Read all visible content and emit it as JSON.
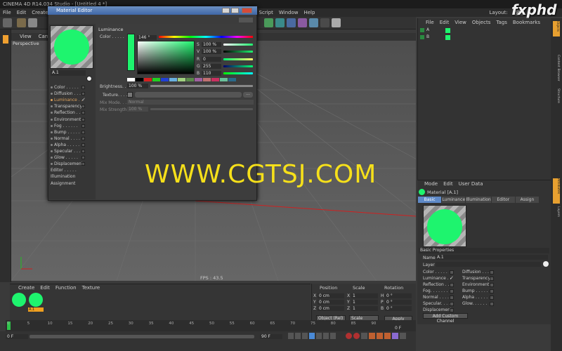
{
  "app": {
    "title": "CINEMA 4D R14.034 Studio - [Untitled 4 *]"
  },
  "menubar": [
    "File",
    "Edit",
    "Create",
    "Script",
    "Window",
    "Help"
  ],
  "layout": {
    "label": "Layout:",
    "value": "St"
  },
  "viewport": {
    "menu": [
      "View",
      "Cameras"
    ],
    "camera_label": "Perspective",
    "fps": "FPS : 43.5"
  },
  "object_manager": {
    "menu": [
      "File",
      "Edit",
      "View",
      "Objects",
      "Tags",
      "Bookmarks"
    ],
    "rows": [
      "A",
      "B"
    ]
  },
  "right_tabs": [
    "Objects",
    "Content Browser",
    "Structure",
    "Attributes",
    "Layers"
  ],
  "left_tabs": [
    "Tags",
    "Coord."
  ],
  "material_editor": {
    "title": "Material Editor",
    "material_name": "A.1",
    "channels": [
      {
        "label": "Color . . . . .",
        "checked": false,
        "active": false
      },
      {
        "label": "Diffusion . . .",
        "checked": false,
        "active": false
      },
      {
        "label": "Luminance . .",
        "checked": true,
        "active": true
      },
      {
        "label": "Transparency",
        "checked": false,
        "active": false
      },
      {
        "label": "Reflection . .",
        "checked": false,
        "active": false
      },
      {
        "label": "Environment",
        "checked": false,
        "active": false
      },
      {
        "label": "Fog . . . . . .",
        "checked": false,
        "active": false
      },
      {
        "label": "Bump . . . . .",
        "checked": false,
        "active": false
      },
      {
        "label": "Normal . . . .",
        "checked": false,
        "active": false
      },
      {
        "label": "Alpha . . . . .",
        "checked": false,
        "active": false
      },
      {
        "label": "Specular . . .",
        "checked": false,
        "active": false
      },
      {
        "label": "Glow . . . . .",
        "checked": false,
        "active": false
      },
      {
        "label": "Displacement",
        "checked": false,
        "active": false
      },
      {
        "label": "Editor . . . . .",
        "checked": null,
        "active": false
      },
      {
        "label": "Illumination",
        "checked": null,
        "active": false
      },
      {
        "label": "Assignment",
        "checked": null,
        "active": false
      }
    ],
    "section": "Luminance",
    "color_label": "Color . . . . .",
    "hue": "146 °",
    "s": "100 %",
    "v": "100 %",
    "r": "0",
    "g": "255",
    "b": "110",
    "brightness_label": "Brightness. .",
    "brightness": "100 %",
    "texture_label": "Texture. . . . .",
    "mix_mode_label": "Mix Mode. . .",
    "mix_mode": "Normal",
    "mix_strength_label": "Mix Strength",
    "mix_strength": "100 %",
    "swatch_color": "#1ef46e"
  },
  "attributes": {
    "menu": [
      "Mode",
      "Edit",
      "User Data"
    ],
    "title": "Material [A.1]",
    "tabs": [
      "Basic",
      "Luminance",
      "Illumination",
      "Editor",
      "Assign"
    ],
    "active_tab": "Basic",
    "section": "Basic Properties",
    "name_label": "Name",
    "name_value": "A.1",
    "layer_label": "Layer",
    "props_left": [
      {
        "label": "Color . . . . .",
        "checked": false
      },
      {
        "label": "Luminance . .",
        "checked": true
      },
      {
        "label": "Reflection . .",
        "checked": false
      },
      {
        "label": "Fog. . . . . . .",
        "checked": false
      },
      {
        "label": "Normal . . . .",
        "checked": false
      },
      {
        "label": "Specular. . . .",
        "checked": false
      },
      {
        "label": "Displacement",
        "checked": false
      }
    ],
    "props_right": [
      {
        "label": "Diffusion . . .",
        "checked": false
      },
      {
        "label": "Transparency",
        "checked": false
      },
      {
        "label": "Environment",
        "checked": false
      },
      {
        "label": "Bump . . . . .",
        "checked": false
      },
      {
        "label": "Alpha . . . . .",
        "checked": false
      },
      {
        "label": "Glow. . . . . .",
        "checked": false
      }
    ],
    "add_channel": "Add Custom Channel"
  },
  "material_manager": {
    "menu": [
      "Create",
      "Edit",
      "Function",
      "Texture"
    ],
    "materials": [
      "",
      "A.1"
    ]
  },
  "coordinates": {
    "headers": [
      "Position",
      "Scale",
      "Rotation"
    ],
    "rows": [
      {
        "a": "X",
        "pos": "0 cm",
        "b": "X",
        "scale": "1",
        "c": "H",
        "rot": "0 °"
      },
      {
        "a": "Y",
        "pos": "0 cm",
        "b": "Y",
        "scale": "1",
        "c": "P",
        "rot": "0 °"
      },
      {
        "a": "Z",
        "pos": "0 cm",
        "b": "Z",
        "scale": "1",
        "c": "B",
        "rot": "0 °"
      }
    ],
    "mode": "Object (Rel)",
    "scale_mode": "Scale",
    "apply": "Apply"
  },
  "timeline": {
    "ticks": [
      "0",
      "5",
      "10",
      "15",
      "20",
      "25",
      "30",
      "35",
      "40",
      "45",
      "50",
      "55",
      "60",
      "65",
      "70",
      "75",
      "80",
      "85",
      "90"
    ],
    "current": "0 F",
    "start": "0 F",
    "end": "90 F",
    "end_right": "0 F"
  },
  "watermark": "WWW.CGTSJ.COM",
  "logo": "fxphd"
}
